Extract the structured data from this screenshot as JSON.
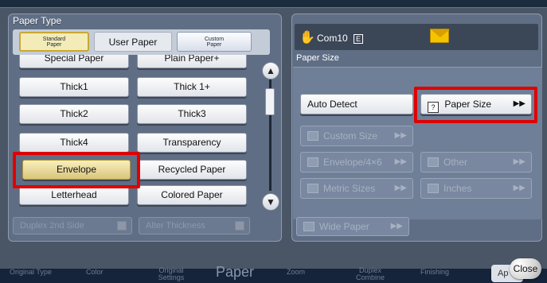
{
  "left_panel": {
    "title": "Paper Type",
    "tabs": [
      {
        "label_line1": "Standard",
        "label_line2": "Paper"
      },
      {
        "label": "User Paper"
      },
      {
        "label_line1": "Custom",
        "label_line2": "Paper"
      }
    ],
    "list": [
      "Special Paper",
      "Plain Paper+",
      "Thick1",
      "Thick 1+",
      "Thick2",
      "Thick3",
      "Thick4",
      "Transparency",
      "Envelope",
      "Recycled Paper",
      "Letterhead",
      "Colored Paper"
    ],
    "options": {
      "duplex": "Duplex 2nd Side",
      "alter": "Alter Thickness"
    }
  },
  "right_panel": {
    "status": "Com10",
    "status_icon_char": "E",
    "section": "Paper Size",
    "auto_detect": "Auto Detect",
    "paper_size": "Paper Size",
    "custom_size": "Custom Size",
    "envelope": "Envelope/4×6",
    "other": "Other",
    "metric": "Metric Sizes",
    "inches": "Inches",
    "wide": "Wide Paper"
  },
  "bottom_nav": {
    "original_type": "Original Type",
    "color": "Color",
    "original_settings_1": "Original",
    "original_settings_2": "Settings",
    "paper": "Paper",
    "zoom": "Zoom",
    "duplex_1": "Duplex",
    "duplex_2": "Combine",
    "finishing": "Finishing",
    "ap": "Ap",
    "close": "Close"
  },
  "colors": {
    "highlight": "#e00000",
    "selected": "#e9d98e"
  }
}
